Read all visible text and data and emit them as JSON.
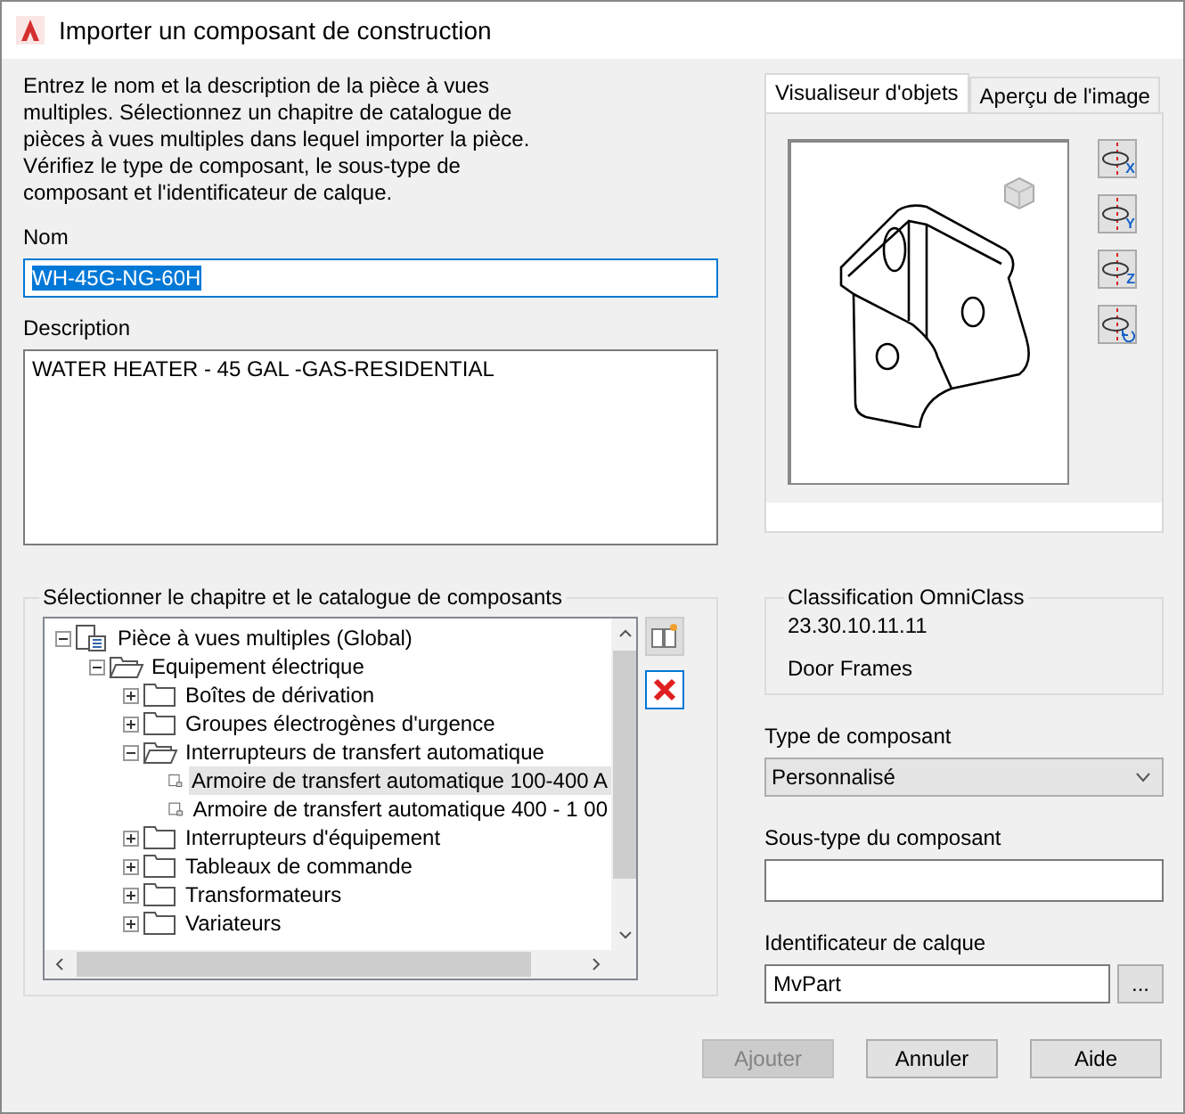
{
  "window": {
    "title": "Importer un composant de construction"
  },
  "intro": "Entrez le nom et la description de la pièce à vues multiples. Sélectionnez un chapitre de catalogue de pièces à vues multiples dans lequel importer la pièce. Vérifiez le type de composant, le sous-type de composant et l'identificateur de calque.",
  "name": {
    "label": "Nom",
    "value": "WH-45G-NG-60H",
    "text_selected": true
  },
  "description": {
    "label": "Description",
    "value": "WATER HEATER - 45 GAL -GAS-RESIDENTIAL"
  },
  "tabs": [
    {
      "label": "Visualiseur d'objets",
      "selected": true
    },
    {
      "label": "Aperçu de l'image",
      "selected": false
    }
  ],
  "rotate_buttons": [
    {
      "kind": "axis",
      "axis": "X"
    },
    {
      "kind": "axis",
      "axis": "Y"
    },
    {
      "kind": "axis",
      "axis": "Z"
    },
    {
      "kind": "reset"
    }
  ],
  "catalog": {
    "label": "Sélectionner le chapitre et le catalogue de composants",
    "tree": [
      {
        "label": "Pièce à vues multiples (Global)",
        "kind": "catalog",
        "expanded": true,
        "selected": false,
        "children": [
          {
            "label": "Equipement électrique",
            "kind": "folder",
            "expanded": true,
            "selected": false,
            "children": [
              {
                "label": "Boîtes de dérivation",
                "kind": "folder",
                "expanded": false,
                "selected": false
              },
              {
                "label": "Groupes électrogènes d'urgence",
                "kind": "folder",
                "expanded": false,
                "selected": false
              },
              {
                "label": "Interrupteurs de transfert automatique",
                "kind": "folder",
                "expanded": true,
                "selected": false,
                "children": [
                  {
                    "label": "Armoire de transfert automatique 100-400 A",
                    "kind": "part",
                    "selected": true
                  },
                  {
                    "label": "Armoire de transfert automatique 400 - 1 00",
                    "kind": "part",
                    "selected": false
                  }
                ]
              },
              {
                "label": "Interrupteurs d'équipement",
                "kind": "folder",
                "expanded": false,
                "selected": false
              },
              {
                "label": "Tableaux de commande",
                "kind": "folder",
                "expanded": false,
                "selected": false
              },
              {
                "label": "Transformateurs",
                "kind": "folder",
                "expanded": false,
                "selected": false
              },
              {
                "label": "Variateurs",
                "kind": "folder",
                "expanded": false,
                "selected": false
              }
            ]
          }
        ]
      }
    ]
  },
  "omniclass": {
    "label": "Classification OmniClass",
    "number": "23.30.10.11.11",
    "title": "Door Frames"
  },
  "component_type": {
    "label": "Type de composant",
    "value": "Personnalisé"
  },
  "component_subtype": {
    "label": "Sous-type du composant"
  },
  "layer_key": {
    "label": "Identificateur de calque",
    "value": "MvPart",
    "browse": "..."
  },
  "buttons": [
    {
      "label": "Ajouter",
      "disabled": true
    },
    {
      "label": "Annuler",
      "disabled": false
    },
    {
      "label": "Aide",
      "disabled": false
    }
  ]
}
